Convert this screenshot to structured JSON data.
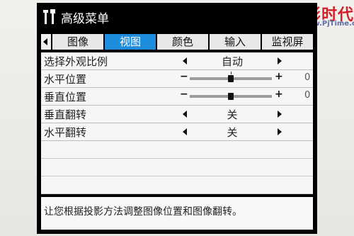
{
  "watermark": {
    "title": "投影时代",
    "url": "www.PjTime.com"
  },
  "menu": {
    "title": "高级菜单",
    "icon": "wrench-screwdriver-icon"
  },
  "tabs": [
    {
      "label": "图像",
      "active": false
    },
    {
      "label": "视图",
      "active": true
    },
    {
      "label": "颜色",
      "active": false
    },
    {
      "label": "输入",
      "active": false
    },
    {
      "label": "监视屏",
      "active": false
    }
  ],
  "rows": [
    {
      "label": "选择外观比例",
      "type": "select",
      "value": "自动"
    },
    {
      "label": "水平位置",
      "type": "slider",
      "minus": "−",
      "plus": "+",
      "value": "0",
      "level": 0.5
    },
    {
      "label": "垂直位置",
      "type": "slider",
      "minus": "−",
      "plus": "+",
      "value": "0",
      "level": 0.5
    },
    {
      "label": "垂直翻转",
      "type": "select",
      "value": "关"
    },
    {
      "label": "水平翻转",
      "type": "select",
      "value": "关"
    }
  ],
  "help_text": "让您根据投影方法调整图像位置和图像翻转。",
  "colors": {
    "accent": "#1f8dde",
    "window": "#000000",
    "panel": "#f6f6f6",
    "watermark_red": "#d21f27"
  }
}
